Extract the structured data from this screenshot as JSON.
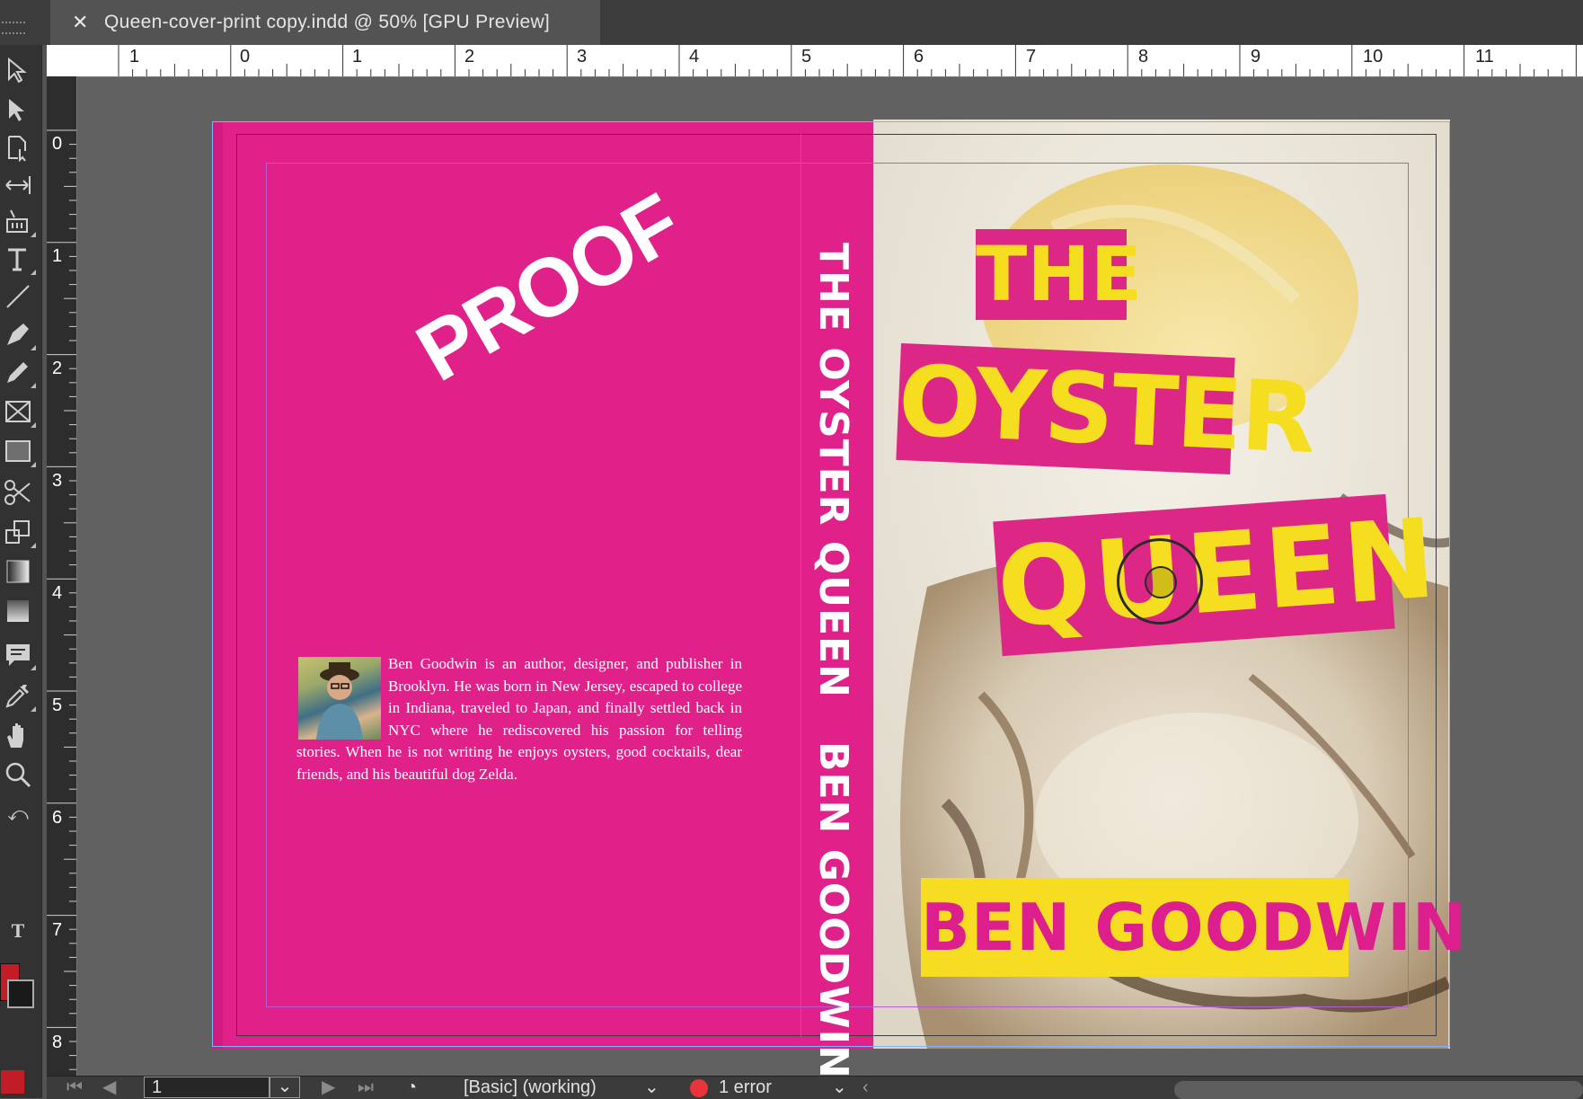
{
  "document_tab": {
    "close_glyph": "✕",
    "title": "Queen-cover-print copy.indd @ 50% [GPU Preview]"
  },
  "rulers": {
    "horizontal": [
      "1",
      "0",
      "1",
      "2",
      "3",
      "4",
      "5",
      "6",
      "7",
      "8",
      "9",
      "10",
      "11"
    ],
    "vertical": [
      "0",
      "1",
      "2",
      "3",
      "4",
      "5",
      "6",
      "7",
      "8"
    ]
  },
  "tools": [
    "direct-selection-icon",
    "selection-icon",
    "page-tool-icon",
    "gap-tool-icon",
    "content-collector-icon",
    "type-tool-icon",
    "line-tool-icon",
    "pen-tool-icon",
    "pencil-tool-icon",
    "rectangle-frame-icon",
    "rectangle-tool-icon",
    "scissors-icon",
    "free-transform-icon",
    "gradient-swatch-icon",
    "gradient-feather-icon",
    "note-tool-icon",
    "eyedropper-icon",
    "hand-icon",
    "zoom-icon"
  ],
  "colors": {
    "cover_pink": "#e0218a",
    "title_yellow": "#f5de1f",
    "fill": "#c21c26"
  },
  "back_cover": {
    "proof": "PROOF",
    "bio": "Ben Goodwin is an author, designer, and publisher in Brooklyn. He was born in New Jersey, escaped to college in Indiana, traveled to Japan, and finally settled back in NYC where he rediscovered his passion for telling stories. When he is not writing he enjoys oysters, good cocktails, dear friends, and his beautiful dog Zelda."
  },
  "spine": {
    "title": "THE OYSTER QUEEN",
    "author": "BEN GOODWIN"
  },
  "front_cover": {
    "title_line1": "THE",
    "title_line2": "OYSTER",
    "title_line3": "QUEEN",
    "author": "BEN GOODWIN"
  },
  "status_bar": {
    "page_number": "1",
    "preflight_profile": "[Basic] (working)",
    "error_text": "1 error"
  }
}
